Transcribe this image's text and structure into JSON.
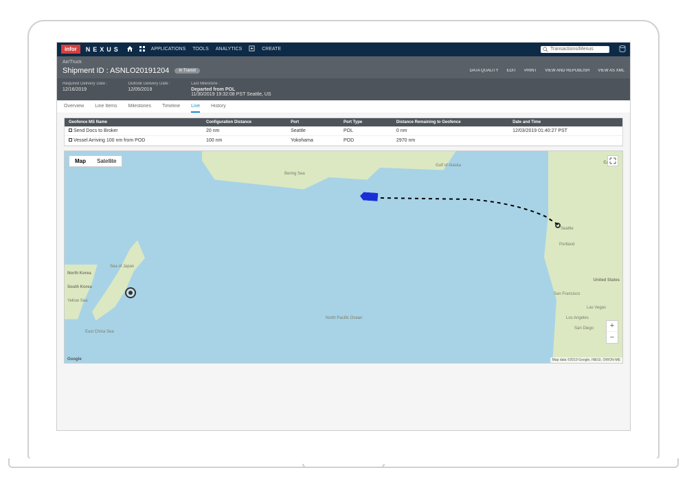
{
  "topbar": {
    "logo": "infor",
    "brand": "NEXUS",
    "nav": [
      "APPLICATIONS",
      "TOOLS",
      "ANALYTICS"
    ],
    "create": "CREATE",
    "search_placeholder": "Transactions/Menus"
  },
  "breadcrumb": "Air/Truck",
  "shipment": {
    "label": "Shipment ID :",
    "id": "ASNLO20191204",
    "status": "In Transit"
  },
  "actions": [
    "DATA QUALITY",
    "EDIT",
    "PRINT",
    "VIEW AND REPUBLISH",
    "VIEW AS XML"
  ],
  "details": {
    "required_delivery": {
      "lbl": "Required Delivery Date :",
      "val": "12/16/2019"
    },
    "outlook_delivery": {
      "lbl": "Outlook Delivery Date :",
      "val": "12/05/2019"
    },
    "last_milestone": {
      "lbl": "Last Milestone :",
      "val1": "Departed from POL",
      "val2": "11/30/2019 19:32:08 PST Seattle, US"
    }
  },
  "tabs": [
    "Overview",
    "Line Items",
    "Milestones",
    "Timeline",
    "Live",
    "History"
  ],
  "active_tab": "Live",
  "table": {
    "headers": [
      "Geofence MS Name",
      "Configuration Distance",
      "Port",
      "Port Type",
      "Distance Remaining to Geofence",
      "Date and Time"
    ],
    "rows": [
      [
        "Send Docs to Broker",
        "20 nm",
        "Seattle",
        "POL",
        "0 nm",
        "12/03/2019 01:40:27 PST"
      ],
      [
        "Vessel Arriving 100 nm from POD",
        "100 nm",
        "Yokohama",
        "POD",
        "2970 nm",
        ""
      ]
    ]
  },
  "map": {
    "types": [
      "Map",
      "Satellite"
    ],
    "labels": {
      "bering": "Bering Sea",
      "alaska": "Gulf of Alaska",
      "npac": "North Pacific Ocean",
      "japansea": "Sea of Japan",
      "nkorea": "North Korea",
      "skorea": "South Korea",
      "yellow": "Yellow Sea",
      "echina": "East China Sea",
      "canada": "Canada",
      "us": "United States",
      "seattle": "Seattle",
      "portland": "Portland",
      "sf": "San Francisco",
      "la": "Los Angeles",
      "lv": "Las Vegas",
      "sd": "San Diego"
    },
    "credits": "Map data ©2019 Google, INEGI, ORION-ME",
    "google": "Google"
  }
}
